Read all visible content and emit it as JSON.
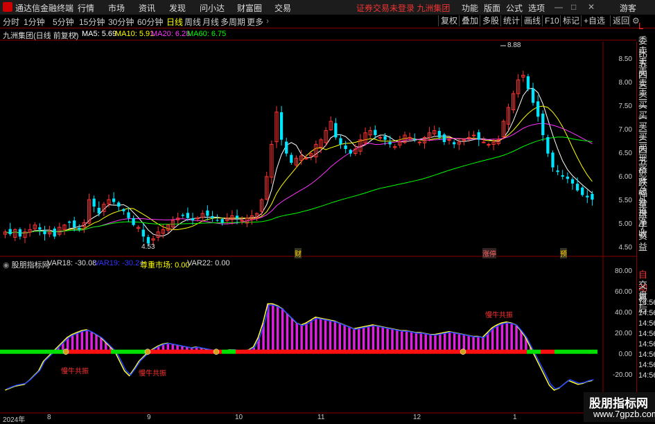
{
  "window": {
    "app_title": "通达信金融终端",
    "menus": [
      "行情",
      "市场",
      "资讯",
      "发现",
      "问小达",
      "财富圈",
      "交易"
    ],
    "notice": "证券交易未登录  九洲集团",
    "right_menus": [
      "功能",
      "版面",
      "公式",
      "选项"
    ],
    "guest": "游客"
  },
  "toolbar": {
    "timeframes": [
      "分时",
      "1分钟",
      "5分钟",
      "15分钟",
      "30分钟",
      "60分钟",
      "日线",
      "周线",
      "月线",
      "多周期",
      "更多"
    ],
    "active_timeframe": "日线",
    "buttons": [
      "复权",
      "叠加",
      "多股",
      "统计",
      "画线",
      "F10",
      "标记",
      "+自选",
      "返回"
    ]
  },
  "main_chart": {
    "stock_name": "九洲集团(日线 前复权)",
    "ma5": "MA5: 5.69",
    "ma10": "MA10: 5.91",
    "ma20": "MA20: 6.28",
    "ma60": "MA60: 6.75",
    "high_label": "8.88",
    "low_label": "4.53",
    "y_ticks": [
      "8.50",
      "8.00",
      "7.50",
      "7.00",
      "6.50",
      "6.00",
      "5.50",
      "5.00",
      "4.50"
    ],
    "markers": [
      "财",
      "涨停",
      "预"
    ],
    "colors": {
      "up": "#ff3333",
      "down": "#00e5ff",
      "ma5": "#ffffff",
      "ma10": "#ffff00",
      "ma20": "#ff33ff",
      "ma60": "#00ff00"
    }
  },
  "indicator": {
    "name": "股朋指标网",
    "var18": "VAR18: -30.08",
    "var19": "VAR19: -30.24",
    "zunzhong": "尊重市场: 0.00",
    "var22": "VAR22: 0.00",
    "labels": [
      "慢牛共振",
      "慢牛共振",
      "慢牛共振"
    ],
    "y_ticks": [
      "80.00",
      "60.00",
      "40.00",
      "20.00",
      "0.00",
      "-20.00"
    ]
  },
  "x_axis": {
    "labels": [
      "2024年",
      "8",
      "9",
      "10",
      "11",
      "12",
      "1"
    ]
  },
  "right_panel": {
    "top_items": [
      "L",
      "委比",
      "卖五",
      "卖四",
      "卖三",
      "卖二",
      "卖一",
      "买一",
      "买二",
      "买三",
      "买四",
      "买五",
      "现价",
      "涨跌",
      "涨幅",
      "总量",
      "外盘",
      "换手",
      "净资",
      "收益"
    ],
    "bottom_items": [
      "自动",
      "交易",
      "盘后",
      "14:56",
      "14:56",
      "14:56",
      "14:56",
      "14:56",
      "14:56",
      "14:56",
      "14:56"
    ]
  },
  "watermark": {
    "title": "股朋指标网",
    "url": "www.7gpzb.com"
  },
  "chart_data": {
    "type": "candlestick",
    "price_range": [
      4.4,
      9.0
    ],
    "closes": [
      4.9,
      4.85,
      4.95,
      4.8,
      4.9,
      4.95,
      5.05,
      4.95,
      4.85,
      4.9,
      4.8,
      5.0,
      5.05,
      5.1,
      5.0,
      4.95,
      5.1,
      5.6,
      5.45,
      5.3,
      5.5,
      5.6,
      5.55,
      5.45,
      5.35,
      5.2,
      5.05,
      5.0,
      4.8,
      4.65,
      4.75,
      4.9,
      4.95,
      5.05,
      5.15,
      5.2,
      5.25,
      5.2,
      5.15,
      5.2,
      5.3,
      5.25,
      5.2,
      5.15,
      5.1,
      5.2,
      5.25,
      5.2,
      5.15,
      5.2,
      5.25,
      5.3,
      5.6,
      6.1,
      6.8,
      7.5,
      6.9,
      6.6,
      6.4,
      6.5,
      6.55,
      6.5,
      6.6,
      6.8,
      6.9,
      7.1,
      7.3,
      6.95,
      6.8,
      6.7,
      6.6,
      6.7,
      6.9,
      7.05,
      7.1,
      7.0,
      6.95,
      6.9,
      6.8,
      6.75,
      6.85,
      7.0,
      6.95,
      6.9,
      6.85,
      6.95,
      7.05,
      7.1,
      6.95,
      6.85,
      6.9,
      6.8,
      6.85,
      6.9,
      6.95,
      7.0,
      6.9,
      6.85,
      6.8,
      6.85,
      6.9,
      7.3,
      7.6,
      7.9,
      8.2,
      8.3,
      8.0,
      7.7,
      7.4,
      7.0,
      6.6,
      6.3,
      6.2,
      6.1,
      6.05,
      5.95,
      5.8,
      5.7,
      5.65,
      5.6
    ],
    "indicator_values": [
      -40,
      -38,
      -36,
      -35,
      -34,
      -30,
      -25,
      -20,
      -10,
      -5,
      0,
      5,
      10,
      15,
      18,
      20,
      22,
      23,
      21,
      18,
      15,
      10,
      5,
      0,
      -10,
      -20,
      -25,
      -18,
      -10,
      -5,
      0,
      3,
      6,
      8,
      9,
      8,
      7,
      6,
      5,
      4,
      5,
      4,
      3,
      2,
      1,
      0,
      1,
      2,
      2,
      1,
      1,
      2,
      5,
      15,
      30,
      50,
      50,
      48,
      45,
      40,
      35,
      30,
      28,
      30,
      33,
      36,
      35,
      34,
      33,
      32,
      30,
      28,
      26,
      24,
      25,
      26,
      27,
      28,
      27,
      26,
      25,
      24,
      23,
      22,
      22,
      21,
      20,
      20,
      19,
      18,
      18,
      19,
      20,
      21,
      20,
      19,
      18,
      17,
      16,
      16,
      15,
      20,
      25,
      28,
      30,
      31,
      30,
      28,
      22,
      15,
      5,
      -5,
      -15,
      -25,
      -35,
      -40,
      -38,
      -34,
      -30,
      -32,
      -34,
      -33,
      -31,
      -30
    ]
  }
}
